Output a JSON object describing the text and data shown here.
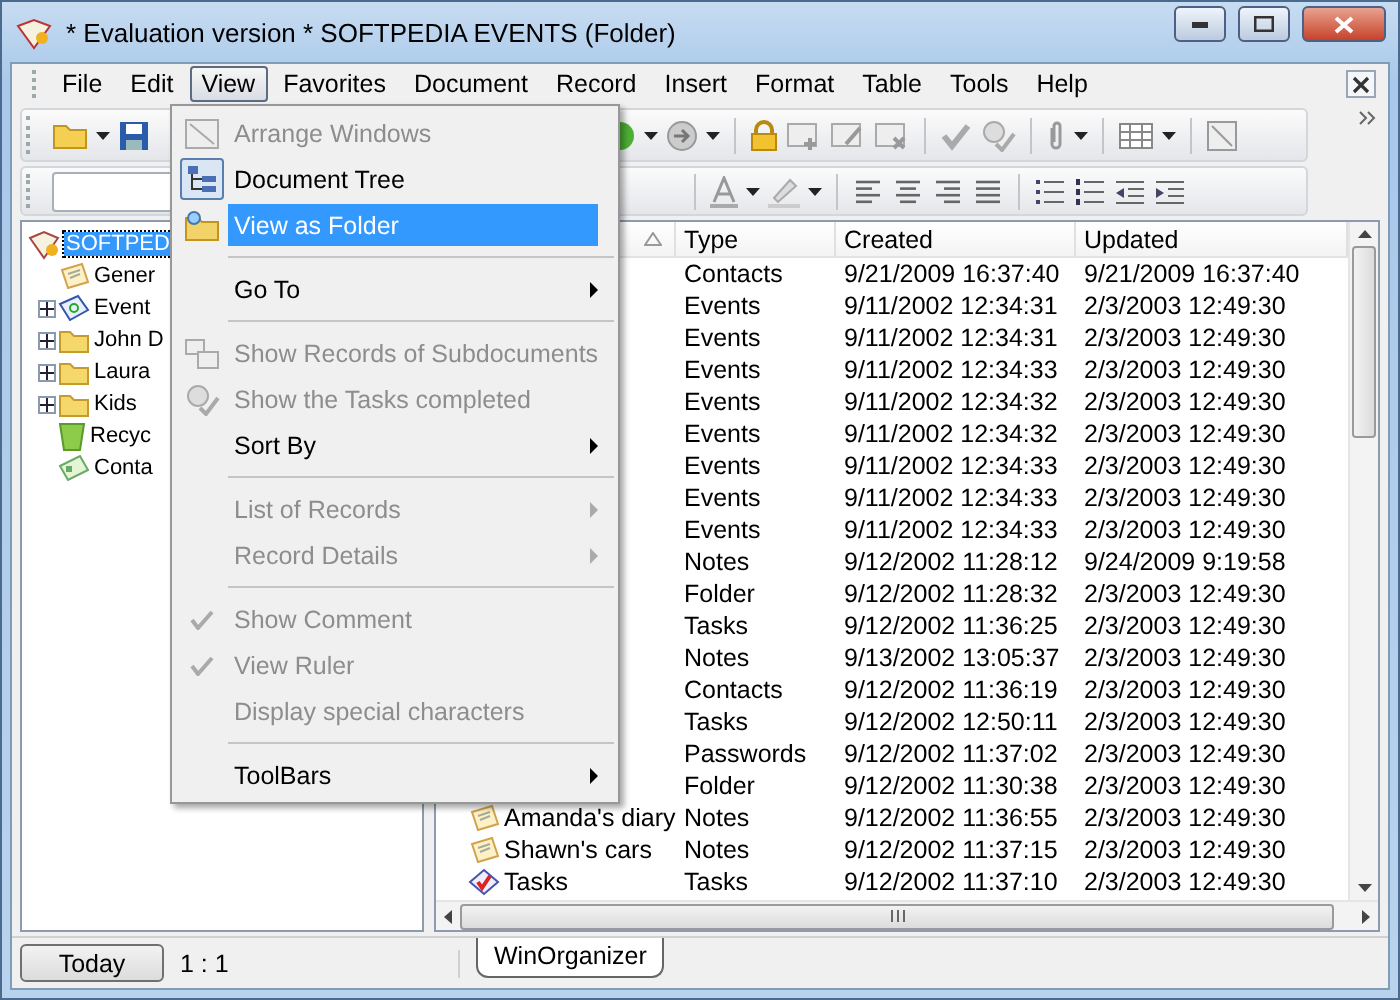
{
  "window": {
    "title": "* Evaluation version * SOFTPEDIA EVENTS (Folder)"
  },
  "menu_bar": [
    {
      "label": "File",
      "selected": false
    },
    {
      "label": "Edit",
      "selected": false
    },
    {
      "label": "View",
      "selected": true
    },
    {
      "label": "Favorites",
      "selected": false
    },
    {
      "label": "Document",
      "selected": false
    },
    {
      "label": "Record",
      "selected": false
    },
    {
      "label": "Insert",
      "selected": false
    },
    {
      "label": "Format",
      "selected": false
    },
    {
      "label": "Table",
      "selected": false
    },
    {
      "label": "Tools",
      "selected": false
    },
    {
      "label": "Help",
      "selected": false
    }
  ],
  "view_menu": [
    {
      "kind": "item",
      "label": "Arrange Windows",
      "disabled": true,
      "selected": false,
      "checked": false,
      "submenu": false
    },
    {
      "kind": "item",
      "label": "Document Tree",
      "disabled": false,
      "selected": false,
      "checked": true,
      "submenu": false
    },
    {
      "kind": "item",
      "label": "View as Folder",
      "disabled": false,
      "selected": true,
      "checked": false,
      "submenu": false
    },
    {
      "kind": "separator"
    },
    {
      "kind": "item",
      "label": "Go To",
      "disabled": false,
      "selected": false,
      "checked": false,
      "submenu": true
    },
    {
      "kind": "separator"
    },
    {
      "kind": "item",
      "label": "Show Records of Subdocuments",
      "disabled": true,
      "selected": false,
      "checked": false,
      "submenu": false
    },
    {
      "kind": "item",
      "label": "Show the Tasks completed",
      "disabled": true,
      "selected": false,
      "checked": false,
      "submenu": false
    },
    {
      "kind": "item",
      "label": "Sort By",
      "disabled": false,
      "selected": false,
      "checked": false,
      "submenu": true
    },
    {
      "kind": "separator"
    },
    {
      "kind": "item",
      "label": "List of Records",
      "disabled": true,
      "selected": false,
      "checked": false,
      "submenu": true
    },
    {
      "kind": "item",
      "label": "Record Details",
      "disabled": true,
      "selected": false,
      "checked": false,
      "submenu": true
    },
    {
      "kind": "separator"
    },
    {
      "kind": "item",
      "label": "Show Comment",
      "disabled": true,
      "selected": false,
      "checked": true,
      "submenu": false
    },
    {
      "kind": "item",
      "label": "View Ruler",
      "disabled": true,
      "selected": false,
      "checked": true,
      "submenu": false
    },
    {
      "kind": "item",
      "label": "Display special characters",
      "disabled": true,
      "selected": false,
      "checked": false,
      "submenu": false
    },
    {
      "kind": "separator"
    },
    {
      "kind": "item",
      "label": "ToolBars",
      "disabled": false,
      "selected": false,
      "checked": false,
      "submenu": true
    }
  ],
  "tree": [
    {
      "label": "SOFTPED",
      "selected": true,
      "children": [
        {
          "label": "Gener",
          "selected": false
        },
        {
          "label": "Event",
          "selected": false,
          "expanded": false
        },
        {
          "label": "John D",
          "selected": false,
          "expanded": false
        },
        {
          "label": "Laura",
          "selected": false,
          "expanded": false
        },
        {
          "label": "Kids",
          "selected": false,
          "expanded": false
        },
        {
          "label": "Recyc",
          "selected": false
        },
        {
          "label": "Conta",
          "selected": false
        }
      ]
    }
  ],
  "table": {
    "columns": [
      {
        "sort_ascending": true
      },
      {
        "label": "Type"
      },
      {
        "label": "Created"
      },
      {
        "label": "Updated"
      }
    ],
    "rows": [
      {
        "type": "Contacts",
        "created": "9/21/2009 16:37:40",
        "updated": "9/21/2009 16:37:40"
      },
      {
        "type": "Events",
        "created": "9/11/2002 12:34:31",
        "updated": "2/3/2003 12:49:30"
      },
      {
        "type": "Events",
        "created": "9/11/2002 12:34:31",
        "updated": "2/3/2003 12:49:30"
      },
      {
        "type": "Events",
        "created": "9/11/2002 12:34:33",
        "updated": "2/3/2003 12:49:30"
      },
      {
        "type": "Events",
        "created": "9/11/2002 12:34:32",
        "updated": "2/3/2003 12:49:30"
      },
      {
        "type": "Events",
        "created": "9/11/2002 12:34:32",
        "updated": "2/3/2003 12:49:30"
      },
      {
        "type": "Events",
        "created": "9/11/2002 12:34:33",
        "updated": "2/3/2003 12:49:30"
      },
      {
        "type": "Events",
        "created": "9/11/2002 12:34:33",
        "updated": "2/3/2003 12:49:30"
      },
      {
        "type": "Events",
        "created": "9/11/2002 12:34:33",
        "updated": "2/3/2003 12:49:30"
      },
      {
        "type": "Notes",
        "created": "9/12/2002 11:28:12",
        "updated": "9/24/2009 9:19:58"
      },
      {
        "type": "Folder",
        "created": "9/12/2002 11:28:32",
        "updated": "2/3/2003 12:49:30"
      },
      {
        "type": "Tasks",
        "created": "9/12/2002 11:36:25",
        "updated": "2/3/2003 12:49:30"
      },
      {
        "type": "Notes",
        "created": "9/13/2002 13:05:37",
        "updated": "2/3/2003 12:49:30"
      },
      {
        "type": "Contacts",
        "created": "9/12/2002 11:36:19",
        "updated": "2/3/2003 12:49:30"
      },
      {
        "type": "Tasks",
        "created": "9/12/2002 12:50:11",
        "updated": "2/3/2003 12:49:30"
      },
      {
        "type": "Passwords",
        "created": "9/12/2002 11:37:02",
        "updated": "2/3/2003 12:49:30"
      },
      {
        "type": "Folder",
        "created": "9/12/2002 11:30:38",
        "updated": "2/3/2003 12:49:30"
      },
      {
        "name": "Amanda's diary",
        "kind": "note",
        "type": "Notes",
        "created": "9/12/2002 11:36:55",
        "updated": "2/3/2003 12:49:30"
      },
      {
        "name": "Shawn's cars",
        "kind": "note",
        "type": "Notes",
        "created": "9/12/2002 11:37:15",
        "updated": "2/3/2003 12:49:30"
      },
      {
        "name": "Tasks",
        "kind": "task",
        "type": "Tasks",
        "created": "9/12/2002 11:37:10",
        "updated": "2/3/2003 12:49:30"
      }
    ]
  },
  "status_bar": {
    "button": "Today",
    "position": "1 : 1",
    "tabs": [
      {
        "label": "WinOrganizer",
        "selected": true
      }
    ]
  }
}
